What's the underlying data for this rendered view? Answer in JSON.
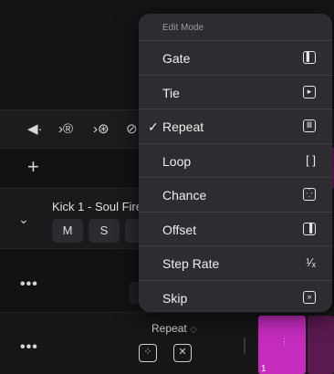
{
  "track": {
    "name": "Kick 1 - Soul Fire",
    "mute_label": "M",
    "solo_label": "S"
  },
  "row4": {
    "edit_label": "Repeat",
    "selector_glyph": "◇"
  },
  "pad": {
    "number": "1"
  },
  "toolbar": {
    "volume_glyph": "◀·",
    "send_r_glyph": "›®",
    "send_fx_glyph": "›⊛",
    "partial_glyph": "⊘"
  },
  "menu": {
    "header": "Edit Mode",
    "items": [
      {
        "label": "Gate",
        "checked": false,
        "icon": "gate-icon",
        "glyph": "▌"
      },
      {
        "label": "Tie",
        "checked": false,
        "icon": "tie-icon",
        "glyph": "▸"
      },
      {
        "label": "Repeat",
        "checked": true,
        "icon": "repeat-icon",
        "glyph": "Ⅲ"
      },
      {
        "label": "Loop",
        "checked": false,
        "icon": "loop-icon",
        "glyph": "[ ]"
      },
      {
        "label": "Chance",
        "checked": false,
        "icon": "chance-icon",
        "glyph": "⁛"
      },
      {
        "label": "Offset",
        "checked": false,
        "icon": "offset-icon",
        "glyph": "▐"
      },
      {
        "label": "Step Rate",
        "checked": false,
        "icon": "step-rate-icon",
        "glyph": "¹⁄ₓ"
      },
      {
        "label": "Skip",
        "checked": false,
        "icon": "skip-icon",
        "glyph": "»"
      }
    ],
    "check_glyph": "✓"
  },
  "colors": {
    "accent_pink": "#c42cbd",
    "menu_bg": "#2d2d31"
  }
}
